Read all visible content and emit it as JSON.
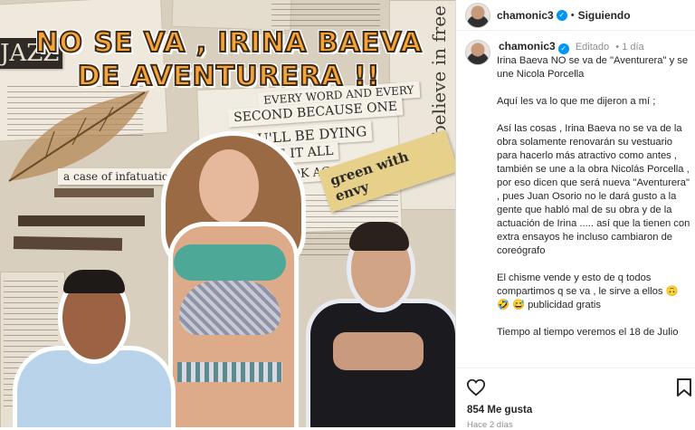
{
  "post_image": {
    "headline_line1": "NO SE VA , IRINA BAEVA",
    "headline_line2": "DE AVENTURERA !!",
    "clip_every_word": "EVERY WORD AND EVERY",
    "clip_second": "SECOND BECAUSE ONE",
    "clip_dying": "YOU'LL BE DYING",
    "clip_have": "HAVE IT ALL",
    "clip_agat": "LOOK AGAT",
    "clip_infatuation": "a case of infatuation",
    "tag_text": "green with envy",
    "side_text": "believe in free",
    "jazz_text": "JAZZ"
  },
  "header": {
    "username": "chamonic3",
    "verified": true,
    "separator": "•",
    "follow_label": "Siguiendo"
  },
  "post": {
    "username": "chamonic3",
    "edited_label": "Editado",
    "time_label": "1 día",
    "caption": [
      "Irina Baeva NO se va de \"Aventurera\" y se une Nicola Porcella",
      "Aquí les va lo que me dijeron a mí ;",
      "Así las cosas , Irina Baeva no se va de la obra solamente renovarán su vestuario para hacerlo más atractivo como antes , también se une a la obra Nicolás Porcella , por eso dicen que será nueva \"Aventurera\" , pues Juan Osorio no le dará gusto a la gente que habló mal de su obra y de la actuación de Irina ..... así que la tienen con extra ensayos he incluso cambiaron de coreógrafo",
      "El chisme vende y esto de q todos compartimos q se va , le sirve a ellos 🙃 🤣 😅 publicidad gratis",
      "Tiempo al tiempo veremos el 18 de Julio"
    ]
  },
  "actions": {
    "likes": "854 Me gusta",
    "posted_ago": "Hace 2 días",
    "icons": [
      "heart-icon",
      "bookmark-icon"
    ]
  },
  "colors": {
    "headline": "#f7a53a",
    "verified": "#0095f6",
    "muted": "#8e8e8e"
  }
}
